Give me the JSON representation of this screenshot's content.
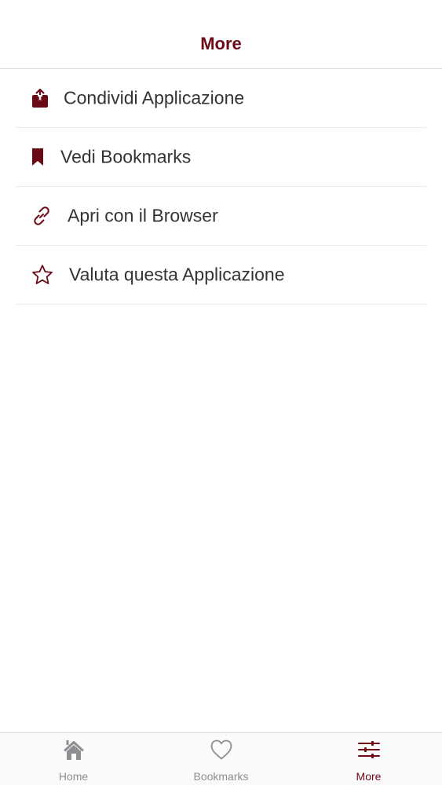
{
  "header": {
    "title": "More"
  },
  "menu": {
    "items": [
      {
        "label": "Condividi Applicazione",
        "icon": "share-icon"
      },
      {
        "label": "Vedi Bookmarks",
        "icon": "bookmark-icon"
      },
      {
        "label": "Apri con il Browser",
        "icon": "link-icon"
      },
      {
        "label": "Valuta questa Applicazione",
        "icon": "star-icon"
      }
    ]
  },
  "tabbar": {
    "tabs": [
      {
        "label": "Home",
        "icon": "home-icon",
        "active": false
      },
      {
        "label": "Bookmarks",
        "icon": "heart-icon",
        "active": false
      },
      {
        "label": "More",
        "icon": "sliders-icon",
        "active": true
      }
    ]
  },
  "colors": {
    "accent": "#6b0a15",
    "inactive": "#8e8e93",
    "text": "#333333"
  }
}
